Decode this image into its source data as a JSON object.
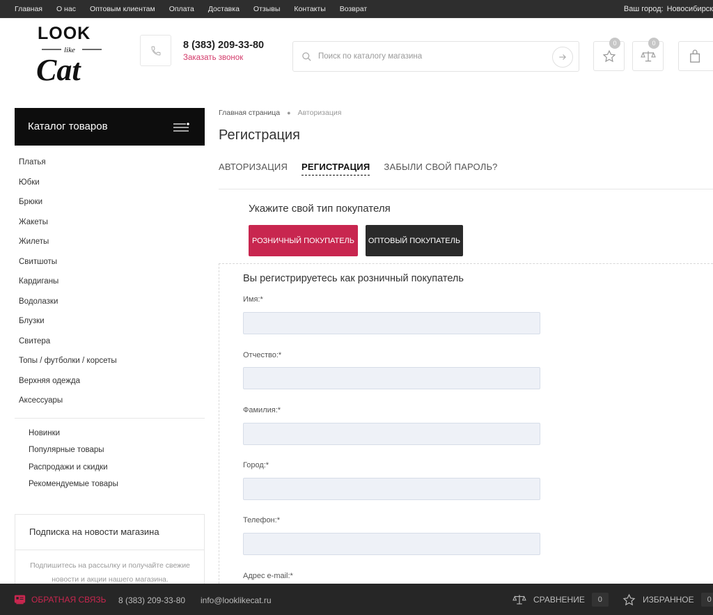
{
  "topnav": {
    "items": [
      "Главная",
      "О нас",
      "Оптовым клиентам",
      "Оплата",
      "Доставка",
      "Отзывы",
      "Контакты",
      "Возврат"
    ],
    "city_label": "Ваш город:",
    "city_value": "Новосибирск"
  },
  "header": {
    "logo_text": "Look like Cat",
    "phone": "8 (383) 209-33-80",
    "callback": "Заказать звонок",
    "search_placeholder": "Поиск по каталогу магазина",
    "favorites_count": "0",
    "compare_count": "0"
  },
  "sidebar": {
    "catalog_title": "Каталог товаров",
    "categories": [
      "Платья",
      "Юбки",
      "Брюки",
      "Жакеты",
      "Жилеты",
      "Свитшоты",
      "Кардиганы",
      "Водолазки",
      "Блузки",
      "Свитера",
      "Топы / футболки / корсеты",
      "Верхняя одежда",
      "Аксессуары"
    ],
    "sub_links": [
      "Новинки",
      "Популярные товары",
      "Распродажи и скидки",
      "Рекомендуемые товары"
    ],
    "subscribe_title": "Подписка на новости магазина",
    "subscribe_desc": "Подпишитесь на рассылку и получайте свежие новости и акции нашего магазина."
  },
  "main": {
    "breadcrumb": [
      "Главная страница",
      "Авторизация"
    ],
    "page_title": "Регистрация",
    "tabs": [
      "АВТОРИЗАЦИЯ",
      "РЕГИСТРАЦИЯ",
      "ЗАБЫЛИ СВОЙ ПАРОЛЬ?"
    ],
    "buyer_type_title": "Укажите свой тип покупателя",
    "retail_button": "РОЗНИЧНЫЙ ПОКУПАТЕЛЬ",
    "wholesale_button": "ОПТОВЫЙ ПОКУПАТЕЛЬ",
    "form_title": "Вы регистрируетесь как розничный покупатель",
    "fields": [
      {
        "label": "Имя:*",
        "value": ""
      },
      {
        "label": "Отчество:*",
        "value": ""
      },
      {
        "label": "Фамилия:*",
        "value": ""
      },
      {
        "label": "Город:*",
        "value": ""
      },
      {
        "label": "Телефон:*",
        "value": ""
      },
      {
        "label": "Адрес e-mail:*",
        "value": ""
      }
    ]
  },
  "bottombar": {
    "feedback": "ОБРАТНАЯ СВЯЗЬ",
    "phone": "8 (383) 209-33-80",
    "email": "info@looklikecat.ru",
    "compare_label": "СРАВНЕНИЕ",
    "compare_count": "0",
    "favorites_label": "ИЗБРАННОЕ",
    "favorites_count": "0"
  },
  "colors": {
    "accent": "#c8264f",
    "dark": "#2a2a2a",
    "topbar": "#2e2e2e",
    "input_bg": "#eef1f7"
  }
}
